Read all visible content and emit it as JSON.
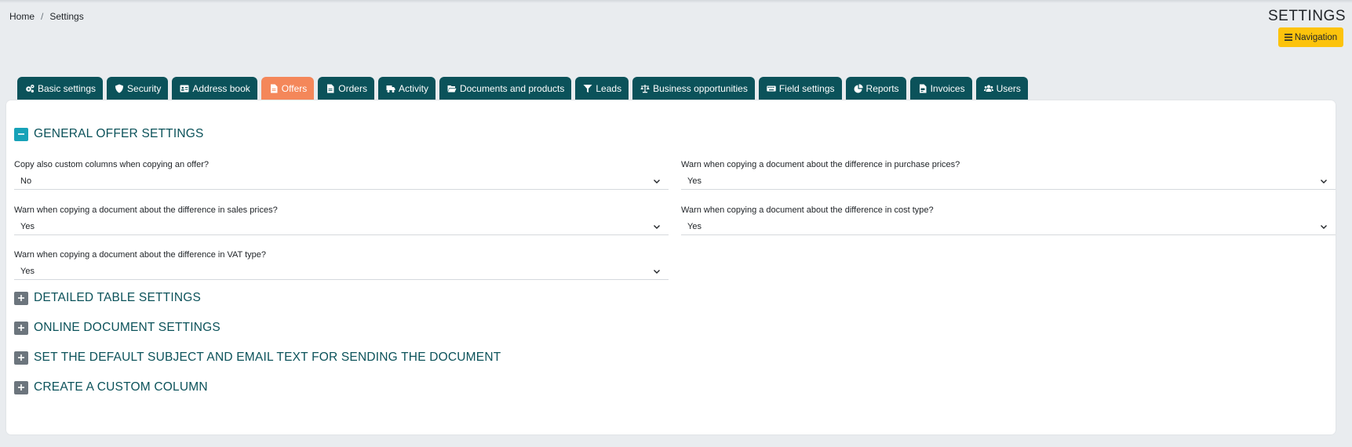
{
  "breadcrumb": {
    "home": "Home",
    "separator": "/",
    "current": "Settings"
  },
  "header": {
    "title": "SETTINGS",
    "nav_button": "Navigation"
  },
  "tabs": [
    {
      "label": "Basic settings",
      "icon": "gears-icon"
    },
    {
      "label": "Security",
      "icon": "shield-icon"
    },
    {
      "label": "Address book",
      "icon": "address-card-icon"
    },
    {
      "label": "Offers",
      "icon": "file-icon",
      "active": true
    },
    {
      "label": "Orders",
      "icon": "file-icon"
    },
    {
      "label": "Activity",
      "icon": "truck-icon"
    },
    {
      "label": "Documents and products",
      "icon": "folder-open-icon"
    },
    {
      "label": "Leads",
      "icon": "funnel-icon"
    },
    {
      "label": "Business opportunities",
      "icon": "scale-icon"
    },
    {
      "label": "Field settings",
      "icon": "keyboard-icon"
    },
    {
      "label": "Reports",
      "icon": "pie-chart-icon"
    },
    {
      "label": "Invoices",
      "icon": "file-invoice-icon"
    },
    {
      "label": "Users",
      "icon": "users-icon"
    }
  ],
  "sections": {
    "general": {
      "title": "GENERAL OFFER SETTINGS",
      "fields": {
        "copy_custom_columns": {
          "label": "Copy also custom columns when copying an offer?",
          "value": "No"
        },
        "warn_purchase_prices": {
          "label": "Warn when copying a document about the difference in purchase prices?",
          "value": "Yes"
        },
        "warn_sales_prices": {
          "label": "Warn when copying a document about the difference in sales prices?",
          "value": "Yes"
        },
        "warn_cost_type": {
          "label": "Warn when copying a document about the difference in cost type?",
          "value": "Yes"
        },
        "warn_vat_type": {
          "label": "Warn when copying a document about the difference in VAT type?",
          "value": "Yes"
        }
      }
    },
    "detailed_table": {
      "title": "DETAILED TABLE SETTINGS"
    },
    "online_document": {
      "title": "ONLINE DOCUMENT SETTINGS"
    },
    "default_subject": {
      "title": "SET THE DEFAULT SUBJECT AND EMAIL TEXT FOR SENDING THE DOCUMENT"
    },
    "custom_column": {
      "title": "CREATE A CUSTOM COLUMN"
    }
  },
  "colors": {
    "tab": "#0b525a",
    "tab_active": "#f4875a",
    "nav_button": "#fcc30c",
    "toggle_open": "#17a2b8",
    "toggle_closed": "#6c757d",
    "title": "#0b525a"
  }
}
